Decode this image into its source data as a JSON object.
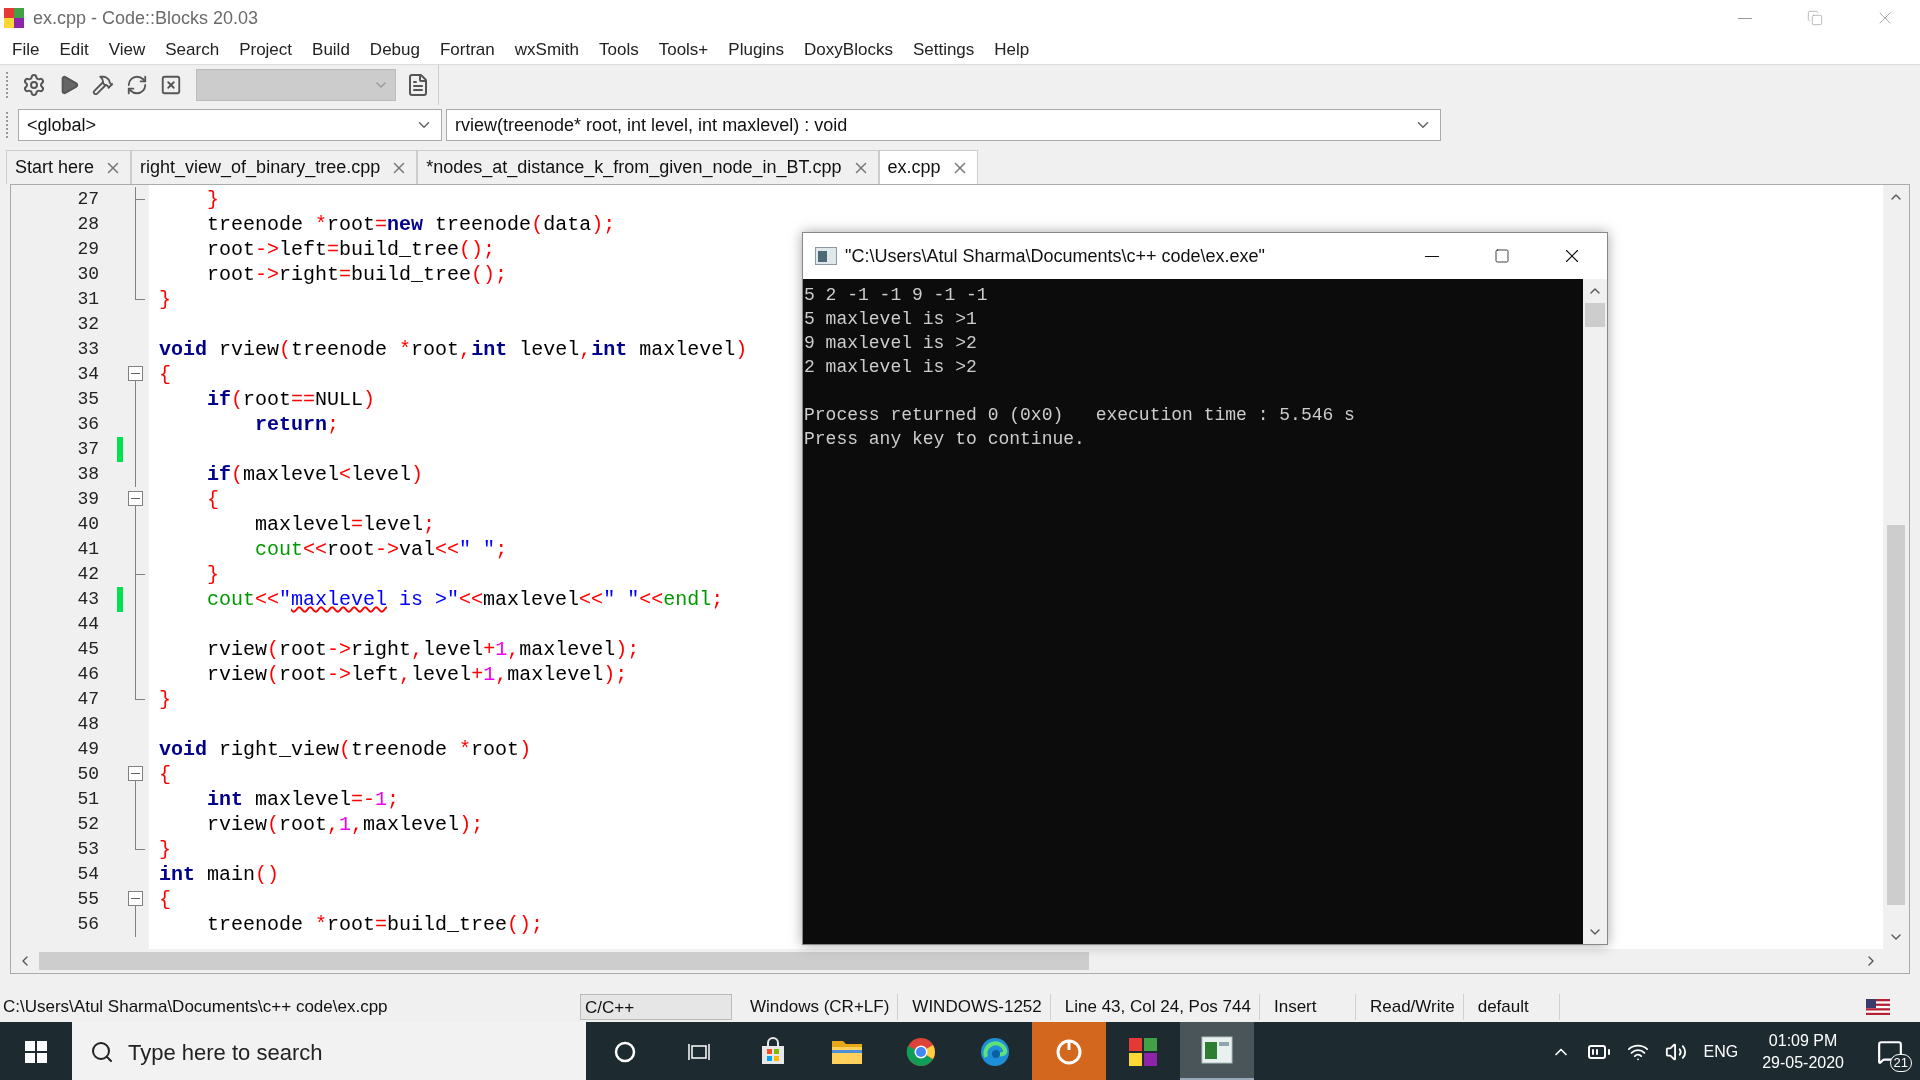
{
  "window": {
    "title": "ex.cpp - Code::Blocks 20.03"
  },
  "menu": [
    "File",
    "Edit",
    "View",
    "Search",
    "Project",
    "Build",
    "Debug",
    "Fortran",
    "wxSmith",
    "Tools",
    "Tools+",
    "Plugins",
    "DoxyBlocks",
    "Settings",
    "Help"
  ],
  "toolbar": {
    "scope": "<global>",
    "function": "rview(treenode* root, int level, int maxlevel) : void"
  },
  "tabs": [
    {
      "label": "Start here",
      "selected": false
    },
    {
      "label": "right_view_of_binary_tree.cpp",
      "selected": false
    },
    {
      "label": "*nodes_at_distance_k_from_given_node_in_BT.cpp",
      "selected": false
    },
    {
      "label": "ex.cpp",
      "selected": true
    }
  ],
  "editor": {
    "lines": [
      {
        "number": "27",
        "kind": "fold_inner_end",
        "changed": false,
        "tokens": [
          {
            "kind": "op",
            "text": "    }"
          }
        ]
      },
      {
        "number": "28",
        "kind": "fold_line",
        "changed": false,
        "tokens": [
          {
            "kind": "plain",
            "text": "    treenode "
          },
          {
            "kind": "op",
            "text": "*"
          },
          {
            "kind": "plain",
            "text": "root"
          },
          {
            "kind": "op",
            "text": "="
          },
          {
            "kind": "kw",
            "text": "new"
          },
          {
            "kind": "plain",
            "text": " treenode"
          },
          {
            "kind": "op",
            "text": "("
          },
          {
            "kind": "plain",
            "text": "data"
          },
          {
            "kind": "op",
            "text": ");"
          }
        ]
      },
      {
        "number": "29",
        "kind": "fold_line",
        "changed": false,
        "tokens": [
          {
            "kind": "plain",
            "text": "    root"
          },
          {
            "kind": "op",
            "text": "->"
          },
          {
            "kind": "plain",
            "text": "left"
          },
          {
            "kind": "op",
            "text": "="
          },
          {
            "kind": "plain",
            "text": "build_tree"
          },
          {
            "kind": "op",
            "text": "();"
          }
        ]
      },
      {
        "number": "30",
        "kind": "fold_line",
        "changed": false,
        "tokens": [
          {
            "kind": "plain",
            "text": "    root"
          },
          {
            "kind": "op",
            "text": "->"
          },
          {
            "kind": "plain",
            "text": "right"
          },
          {
            "kind": "op",
            "text": "="
          },
          {
            "kind": "plain",
            "text": "build_tree"
          },
          {
            "kind": "op",
            "text": "();"
          }
        ]
      },
      {
        "number": "31",
        "kind": "fold_end",
        "changed": false,
        "tokens": [
          {
            "kind": "op",
            "text": "}"
          }
        ]
      },
      {
        "number": "32",
        "kind": "fold_none",
        "changed": false
      },
      {
        "number": "33",
        "kind": "fold_none",
        "changed": false,
        "tokens": [
          {
            "kind": "kw",
            "text": "void"
          },
          {
            "kind": "plain",
            "text": " rview"
          },
          {
            "kind": "op",
            "text": "("
          },
          {
            "kind": "plain",
            "text": "treenode "
          },
          {
            "kind": "op",
            "text": "*"
          },
          {
            "kind": "plain",
            "text": "root"
          },
          {
            "kind": "op",
            "text": ","
          },
          {
            "kind": "kw",
            "text": "int"
          },
          {
            "kind": "plain",
            "text": " level"
          },
          {
            "kind": "op",
            "text": ","
          },
          {
            "kind": "kw",
            "text": "int"
          },
          {
            "kind": "plain",
            "text": " maxlevel"
          },
          {
            "kind": "op",
            "text": ")"
          }
        ]
      },
      {
        "number": "34",
        "kind": "fold_open",
        "changed": false,
        "tokens": [
          {
            "kind": "op",
            "text": "{"
          }
        ]
      },
      {
        "number": "35",
        "kind": "fold_line",
        "changed": false,
        "tokens": [
          {
            "kind": "kw",
            "text": "    if"
          },
          {
            "kind": "op",
            "text": "("
          },
          {
            "kind": "plain",
            "text": "root"
          },
          {
            "kind": "op",
            "text": "=="
          },
          {
            "kind": "plain",
            "text": "NULL"
          },
          {
            "kind": "op",
            "text": ")"
          }
        ]
      },
      {
        "number": "36",
        "kind": "fold_line",
        "changed": false,
        "tokens": [
          {
            "kind": "kw",
            "text": "        return"
          },
          {
            "kind": "op",
            "text": ";"
          }
        ]
      },
      {
        "number": "37",
        "kind": "fold_line",
        "changed": true
      },
      {
        "number": "38",
        "kind": "fold_line",
        "changed": false,
        "tokens": [
          {
            "kind": "kw",
            "text": "    if"
          },
          {
            "kind": "op",
            "text": "("
          },
          {
            "kind": "plain",
            "text": "maxlevel"
          },
          {
            "kind": "op",
            "text": "<"
          },
          {
            "kind": "plain",
            "text": "level"
          },
          {
            "kind": "op",
            "text": ")"
          }
        ]
      },
      {
        "number": "39",
        "kind": "fold_open",
        "changed": false,
        "tokens": [
          {
            "kind": "op",
            "text": "    {"
          }
        ]
      },
      {
        "number": "40",
        "kind": "fold_line",
        "changed": false,
        "tokens": [
          {
            "kind": "plain",
            "text": "        maxlevel"
          },
          {
            "kind": "op",
            "text": "="
          },
          {
            "kind": "plain",
            "text": "level"
          },
          {
            "kind": "op",
            "text": ";"
          }
        ]
      },
      {
        "number": "41",
        "kind": "fold_line",
        "changed": false,
        "tokens": [
          {
            "kind": "lib",
            "text": "        cout"
          },
          {
            "kind": "op",
            "text": "<<"
          },
          {
            "kind": "plain",
            "text": "root"
          },
          {
            "kind": "op",
            "text": "->"
          },
          {
            "kind": "plain",
            "text": "val"
          },
          {
            "kind": "op",
            "text": "<<"
          },
          {
            "kind": "str",
            "text": "\" \""
          },
          {
            "kind": "op",
            "text": ";"
          }
        ]
      },
      {
        "number": "42",
        "kind": "fold_inner_end",
        "changed": false,
        "tokens": [
          {
            "kind": "op",
            "text": "    }"
          }
        ]
      },
      {
        "number": "43",
        "kind": "fold_line",
        "changed": true,
        "tokens": [
          {
            "kind": "lib",
            "text": "    cout"
          },
          {
            "kind": "op",
            "text": "<<"
          },
          {
            "kind": "str",
            "text": "\""
          },
          {
            "kind": "typo",
            "text": "maxlevel"
          },
          {
            "kind": "str",
            "text": " is >\""
          },
          {
            "kind": "op",
            "text": "<<"
          },
          {
            "kind": "plain",
            "text": "maxlevel"
          },
          {
            "kind": "op",
            "text": "<<"
          },
          {
            "kind": "str",
            "text": "\" \""
          },
          {
            "kind": "op",
            "text": "<<"
          },
          {
            "kind": "lib",
            "text": "endl"
          },
          {
            "kind": "op",
            "text": ";"
          }
        ]
      },
      {
        "number": "44",
        "kind": "fold_line",
        "changed": false
      },
      {
        "number": "45",
        "kind": "fold_line",
        "changed": false,
        "tokens": [
          {
            "kind": "plain",
            "text": "    rview"
          },
          {
            "kind": "op",
            "text": "("
          },
          {
            "kind": "plain",
            "text": "root"
          },
          {
            "kind": "op",
            "text": "->"
          },
          {
            "kind": "plain",
            "text": "right"
          },
          {
            "kind": "op",
            "text": ","
          },
          {
            "kind": "plain",
            "text": "level"
          },
          {
            "kind": "op",
            "text": "+"
          },
          {
            "kind": "num",
            "text": "1"
          },
          {
            "kind": "op",
            "text": ","
          },
          {
            "kind": "plain",
            "text": "maxlevel"
          },
          {
            "kind": "op",
            "text": ");"
          }
        ]
      },
      {
        "number": "46",
        "kind": "fold_line",
        "changed": false,
        "tokens": [
          {
            "kind": "plain",
            "text": "    rview"
          },
          {
            "kind": "op",
            "text": "("
          },
          {
            "kind": "plain",
            "text": "root"
          },
          {
            "kind": "op",
            "text": "->"
          },
          {
            "kind": "plain",
            "text": "left"
          },
          {
            "kind": "op",
            "text": ","
          },
          {
            "kind": "plain",
            "text": "level"
          },
          {
            "kind": "op",
            "text": "+"
          },
          {
            "kind": "num",
            "text": "1"
          },
          {
            "kind": "op",
            "text": ","
          },
          {
            "kind": "plain",
            "text": "maxlevel"
          },
          {
            "kind": "op",
            "text": ");"
          }
        ]
      },
      {
        "number": "47",
        "kind": "fold_end",
        "changed": false,
        "tokens": [
          {
            "kind": "op",
            "text": "}"
          }
        ]
      },
      {
        "number": "48",
        "kind": "fold_none",
        "changed": false
      },
      {
        "number": "49",
        "kind": "fold_none",
        "changed": false,
        "tokens": [
          {
            "kind": "kw",
            "text": "void"
          },
          {
            "kind": "plain",
            "text": " right_view"
          },
          {
            "kind": "op",
            "text": "("
          },
          {
            "kind": "plain",
            "text": "treenode "
          },
          {
            "kind": "op",
            "text": "*"
          },
          {
            "kind": "plain",
            "text": "root"
          },
          {
            "kind": "op",
            "text": ")"
          }
        ]
      },
      {
        "number": "50",
        "kind": "fold_open",
        "changed": false,
        "tokens": [
          {
            "kind": "op",
            "text": "{"
          }
        ]
      },
      {
        "number": "51",
        "kind": "fold_line",
        "changed": false,
        "tokens": [
          {
            "kind": "kw",
            "text": "    int"
          },
          {
            "kind": "plain",
            "text": " maxlevel"
          },
          {
            "kind": "op",
            "text": "=-"
          },
          {
            "kind": "num",
            "text": "1"
          },
          {
            "kind": "op",
            "text": ";"
          }
        ]
      },
      {
        "number": "52",
        "kind": "fold_line",
        "changed": false,
        "tokens": [
          {
            "kind": "plain",
            "text": "    rview"
          },
          {
            "kind": "op",
            "text": "("
          },
          {
            "kind": "plain",
            "text": "root"
          },
          {
            "kind": "op",
            "text": ","
          },
          {
            "kind": "num",
            "text": "1"
          },
          {
            "kind": "op",
            "text": ","
          },
          {
            "kind": "plain",
            "text": "maxlevel"
          },
          {
            "kind": "op",
            "text": ");"
          }
        ]
      },
      {
        "number": "53",
        "kind": "fold_end",
        "changed": false,
        "tokens": [
          {
            "kind": "op",
            "text": "}"
          }
        ]
      },
      {
        "number": "54",
        "kind": "fold_none",
        "changed": false,
        "tokens": [
          {
            "kind": "kw",
            "text": "int"
          },
          {
            "kind": "plain",
            "text": " main"
          },
          {
            "kind": "op",
            "text": "()"
          }
        ]
      },
      {
        "number": "55",
        "kind": "fold_open",
        "changed": false,
        "tokens": [
          {
            "kind": "op",
            "text": "{"
          }
        ]
      },
      {
        "number": "56",
        "kind": "fold_line",
        "changed": false,
        "tokens": [
          {
            "kind": "plain",
            "text": "    treenode "
          },
          {
            "kind": "op",
            "text": "*"
          },
          {
            "kind": "plain",
            "text": "root"
          },
          {
            "kind": "op",
            "text": "="
          },
          {
            "kind": "plain",
            "text": "build_tree"
          },
          {
            "kind": "op",
            "text": "();"
          }
        ]
      }
    ]
  },
  "console": {
    "title": "\"C:\\Users\\Atul Sharma\\Documents\\c++ code\\ex.exe\"",
    "output": [
      "5 2 -1 -1 9 -1 -1",
      "5 maxlevel is >1",
      "9 maxlevel is >2",
      "2 maxlevel is >2"
    ],
    "footer": [
      "Process returned 0 (0x0)   execution time : 5.546 s",
      "Press any key to continue."
    ]
  },
  "status_bar": [
    {
      "kind": "path",
      "text": "C:\\Users\\Atul Sharma\\Documents\\c++ code\\ex.cpp"
    },
    {
      "kind": "sunken",
      "text": "C/C++"
    },
    {
      "kind": "field",
      "text": "Windows (CR+LF)"
    },
    {
      "kind": "field",
      "text": "WINDOWS-1252"
    },
    {
      "kind": "field",
      "text": "Line 43, Col 24, Pos 744"
    },
    {
      "kind": "field",
      "text": "Insert"
    },
    {
      "kind": "field",
      "text": "Read/Write"
    },
    {
      "kind": "field",
      "text": "default"
    }
  ],
  "taskbar": {
    "search_placeholder": "Type here to search",
    "apps": [
      {
        "kind": "cortana",
        "selected": false
      },
      {
        "kind": "taskview",
        "selected": false
      },
      {
        "kind": "store",
        "selected": false
      },
      {
        "kind": "explorer",
        "selected": false
      },
      {
        "kind": "chrome",
        "selected": false
      },
      {
        "kind": "edge",
        "selected": false
      },
      {
        "kind": "orange",
        "selected": false
      },
      {
        "kind": "blocks",
        "selected": false
      },
      {
        "kind": "console",
        "selected": true
      }
    ],
    "language": "ENG",
    "time": "01:09 PM",
    "date": "29-05-2020",
    "notifications": "21"
  }
}
